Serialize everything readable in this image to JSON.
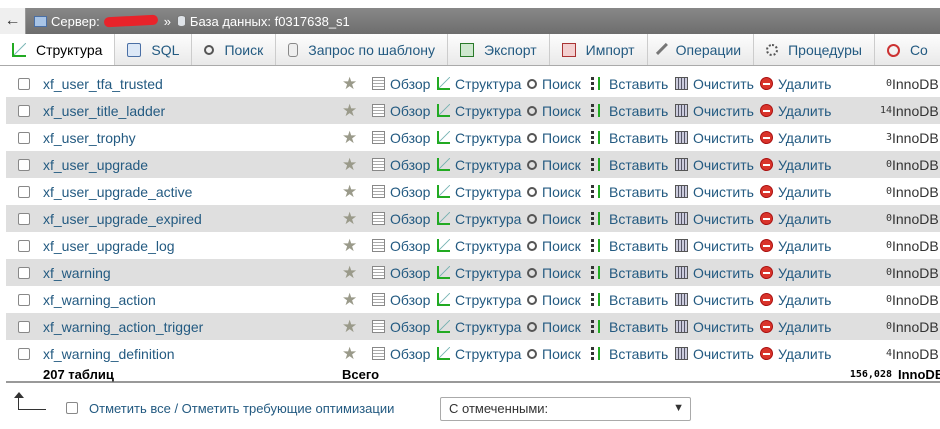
{
  "breadcrumb": {
    "back_symbol": "←",
    "server_label": "Сервер:",
    "separator": "»",
    "db_label": "База данных:",
    "db_name": "f0317638_s1"
  },
  "tabs": [
    {
      "label": "Структура",
      "icon": "structure-icon",
      "active": true
    },
    {
      "label": "SQL",
      "icon": "sql-icon"
    },
    {
      "label": "Поиск",
      "icon": "search-icon"
    },
    {
      "label": "Запрос по шаблону",
      "icon": "query-icon"
    },
    {
      "label": "Экспорт",
      "icon": "export-icon"
    },
    {
      "label": "Импорт",
      "icon": "import-icon"
    },
    {
      "label": "Операции",
      "icon": "operations-icon"
    },
    {
      "label": "Процедуры",
      "icon": "procedures-icon"
    },
    {
      "label": "Со",
      "icon": "events-icon"
    }
  ],
  "actions": {
    "browse": "Обзор",
    "structure": "Структура",
    "search": "Поиск",
    "insert": "Вставить",
    "empty": "Очистить",
    "drop": "Удалить"
  },
  "tables": [
    {
      "name": "xf_user_tfa_trusted",
      "rows": "0",
      "engine": "InnoDB"
    },
    {
      "name": "xf_user_title_ladder",
      "rows": "14",
      "engine": "InnoDB"
    },
    {
      "name": "xf_user_trophy",
      "rows": "3",
      "engine": "InnoDB"
    },
    {
      "name": "xf_user_upgrade",
      "rows": "0",
      "engine": "InnoDB"
    },
    {
      "name": "xf_user_upgrade_active",
      "rows": "0",
      "engine": "InnoDB"
    },
    {
      "name": "xf_user_upgrade_expired",
      "rows": "0",
      "engine": "InnoDB"
    },
    {
      "name": "xf_user_upgrade_log",
      "rows": "0",
      "engine": "InnoDB"
    },
    {
      "name": "xf_warning",
      "rows": "0",
      "engine": "InnoDB"
    },
    {
      "name": "xf_warning_action",
      "rows": "0",
      "engine": "InnoDB"
    },
    {
      "name": "xf_warning_action_trigger",
      "rows": "0",
      "engine": "InnoDB"
    },
    {
      "name": "xf_warning_definition",
      "rows": "4",
      "engine": "InnoDB"
    }
  ],
  "summary": {
    "count": "207 таблиц",
    "total_label": "Всего",
    "total_rows": "156,028",
    "engine": "InnoDB"
  },
  "footer": {
    "check_label": "Отметить все / Отметить требующие оптимизации",
    "select_value": "С отмеченными:"
  }
}
